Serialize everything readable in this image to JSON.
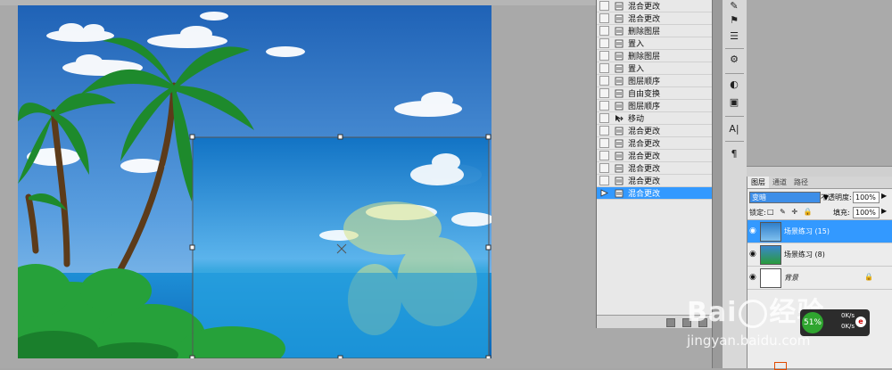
{
  "history": {
    "items": [
      {
        "label": "混合更改",
        "icon": "brush-icon",
        "selected": false
      },
      {
        "label": "混合更改",
        "icon": "brush-icon",
        "selected": false
      },
      {
        "label": "删除图层",
        "icon": "brush-icon",
        "selected": false
      },
      {
        "label": "置入",
        "icon": "brush-icon",
        "selected": false
      },
      {
        "label": "删除图层",
        "icon": "brush-icon",
        "selected": false
      },
      {
        "label": "置入",
        "icon": "brush-icon",
        "selected": false
      },
      {
        "label": "图层顺序",
        "icon": "brush-icon",
        "selected": false
      },
      {
        "label": "自由变换",
        "icon": "brush-icon",
        "selected": false
      },
      {
        "label": "图层顺序",
        "icon": "brush-icon",
        "selected": false
      },
      {
        "label": "移动",
        "icon": "move-icon",
        "selected": false
      },
      {
        "label": "混合更改",
        "icon": "brush-icon",
        "selected": false
      },
      {
        "label": "混合更改",
        "icon": "brush-icon",
        "selected": false
      },
      {
        "label": "混合更改",
        "icon": "brush-icon",
        "selected": false
      },
      {
        "label": "混合更改",
        "icon": "brush-icon",
        "selected": false
      },
      {
        "label": "混合更改",
        "icon": "brush-icon",
        "selected": false
      },
      {
        "label": "混合更改",
        "icon": "brush-icon",
        "selected": true
      }
    ]
  },
  "layers": {
    "tabs": [
      "图层",
      "通道",
      "路径"
    ],
    "blend_mode": "变暗",
    "opacity_label": "不透明度:",
    "opacity_value": "100%",
    "lock_label": "锁定:",
    "fill_label": "填充:",
    "fill_value": "100%",
    "rows": [
      {
        "name": "场景练习 (15)",
        "selected": true
      },
      {
        "name": "场景练习 (8)",
        "selected": false
      },
      {
        "name": "背景",
        "selected": false
      }
    ]
  },
  "watermark": {
    "logo_text": "Bai",
    "logo_text2": "经验",
    "url": "jingyan.baidu.com"
  },
  "net_monitor": {
    "percent": "51%",
    "up": "0K/s",
    "down": "0K/s"
  },
  "colors": {
    "selection": "#3399ff",
    "panel_bg": "#e8e8e8",
    "sky": "#4d8fd0"
  }
}
